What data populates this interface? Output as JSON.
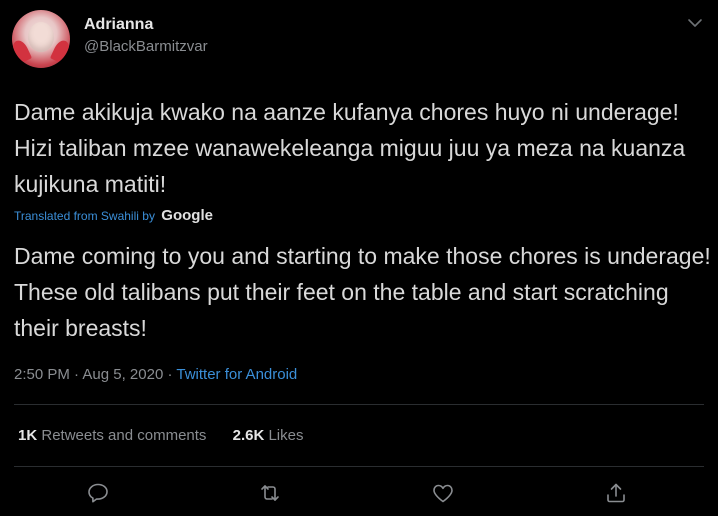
{
  "user": {
    "name": "Adrianna",
    "handle": "@BlackBarmitzvar"
  },
  "tweet": {
    "original_text": "Dame akikuja kwako na aanze kufanya chores huyo ni underage! Hizi taliban mzee wanawekeleanga miguu juu ya meza na kuanza kujikuna matiti!",
    "translated_from_label": "Translated from Swahili by",
    "translation_provider": "Google",
    "translated_text": "Dame coming to you and starting to make those chores is underage! These old talibans put their feet on the table and start scratching their breasts!",
    "time": "2:50 PM",
    "date": "Aug 5, 2020",
    "separator": "·",
    "source": "Twitter for Android"
  },
  "stats": {
    "retweets_count": "1K",
    "retweets_label": "Retweets and comments",
    "likes_count": "2.6K",
    "likes_label": "Likes"
  },
  "icons": {
    "menu": "chevron-down-icon",
    "reply": "reply-icon",
    "retweet": "retweet-icon",
    "like": "like-icon",
    "share": "share-icon"
  },
  "colors": {
    "background": "#000000",
    "link": "#3b8fd8",
    "muted": "#8a8d91",
    "text": "#d9d9d9"
  }
}
